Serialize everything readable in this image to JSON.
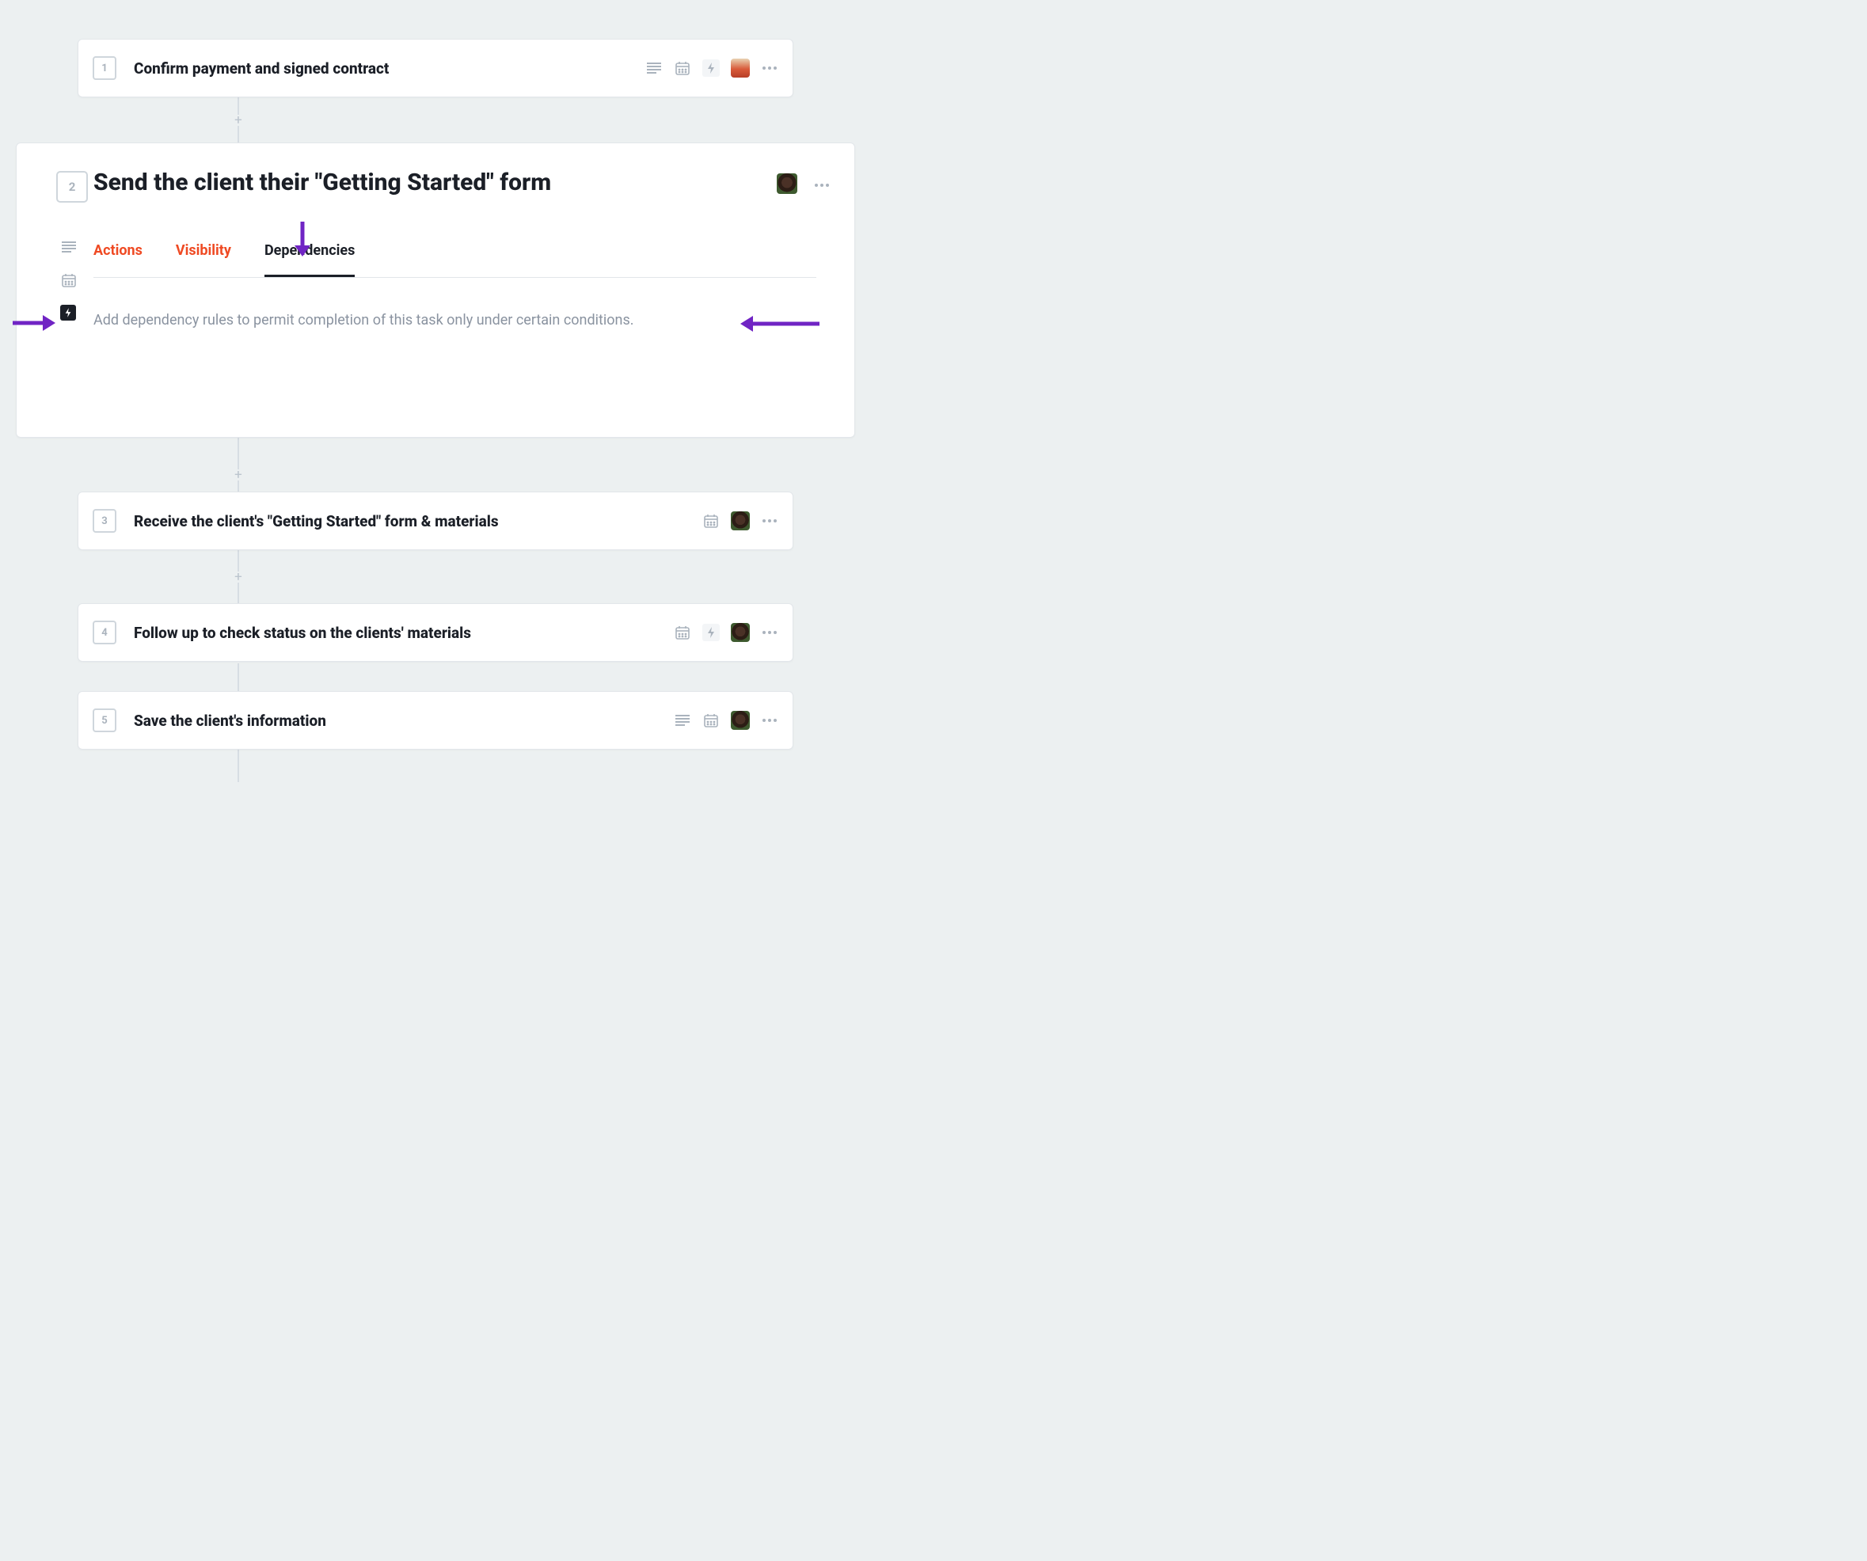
{
  "tasks": [
    {
      "num": "1",
      "title": "Confirm payment and signed contract"
    },
    {
      "num": "2",
      "title": "Send the client their \"Getting Started\" form"
    },
    {
      "num": "3",
      "title": "Receive the client's \"Getting Started\" form & materials"
    },
    {
      "num": "4",
      "title": "Follow up to check status on the clients' materials"
    },
    {
      "num": "5",
      "title": "Save the client's information"
    }
  ],
  "expanded": {
    "tabs": {
      "actions": "Actions",
      "visibility": "Visibility",
      "dependencies": "Dependencies"
    },
    "help_text": "Add dependency rules to permit completion of this task only under certain conditions."
  }
}
